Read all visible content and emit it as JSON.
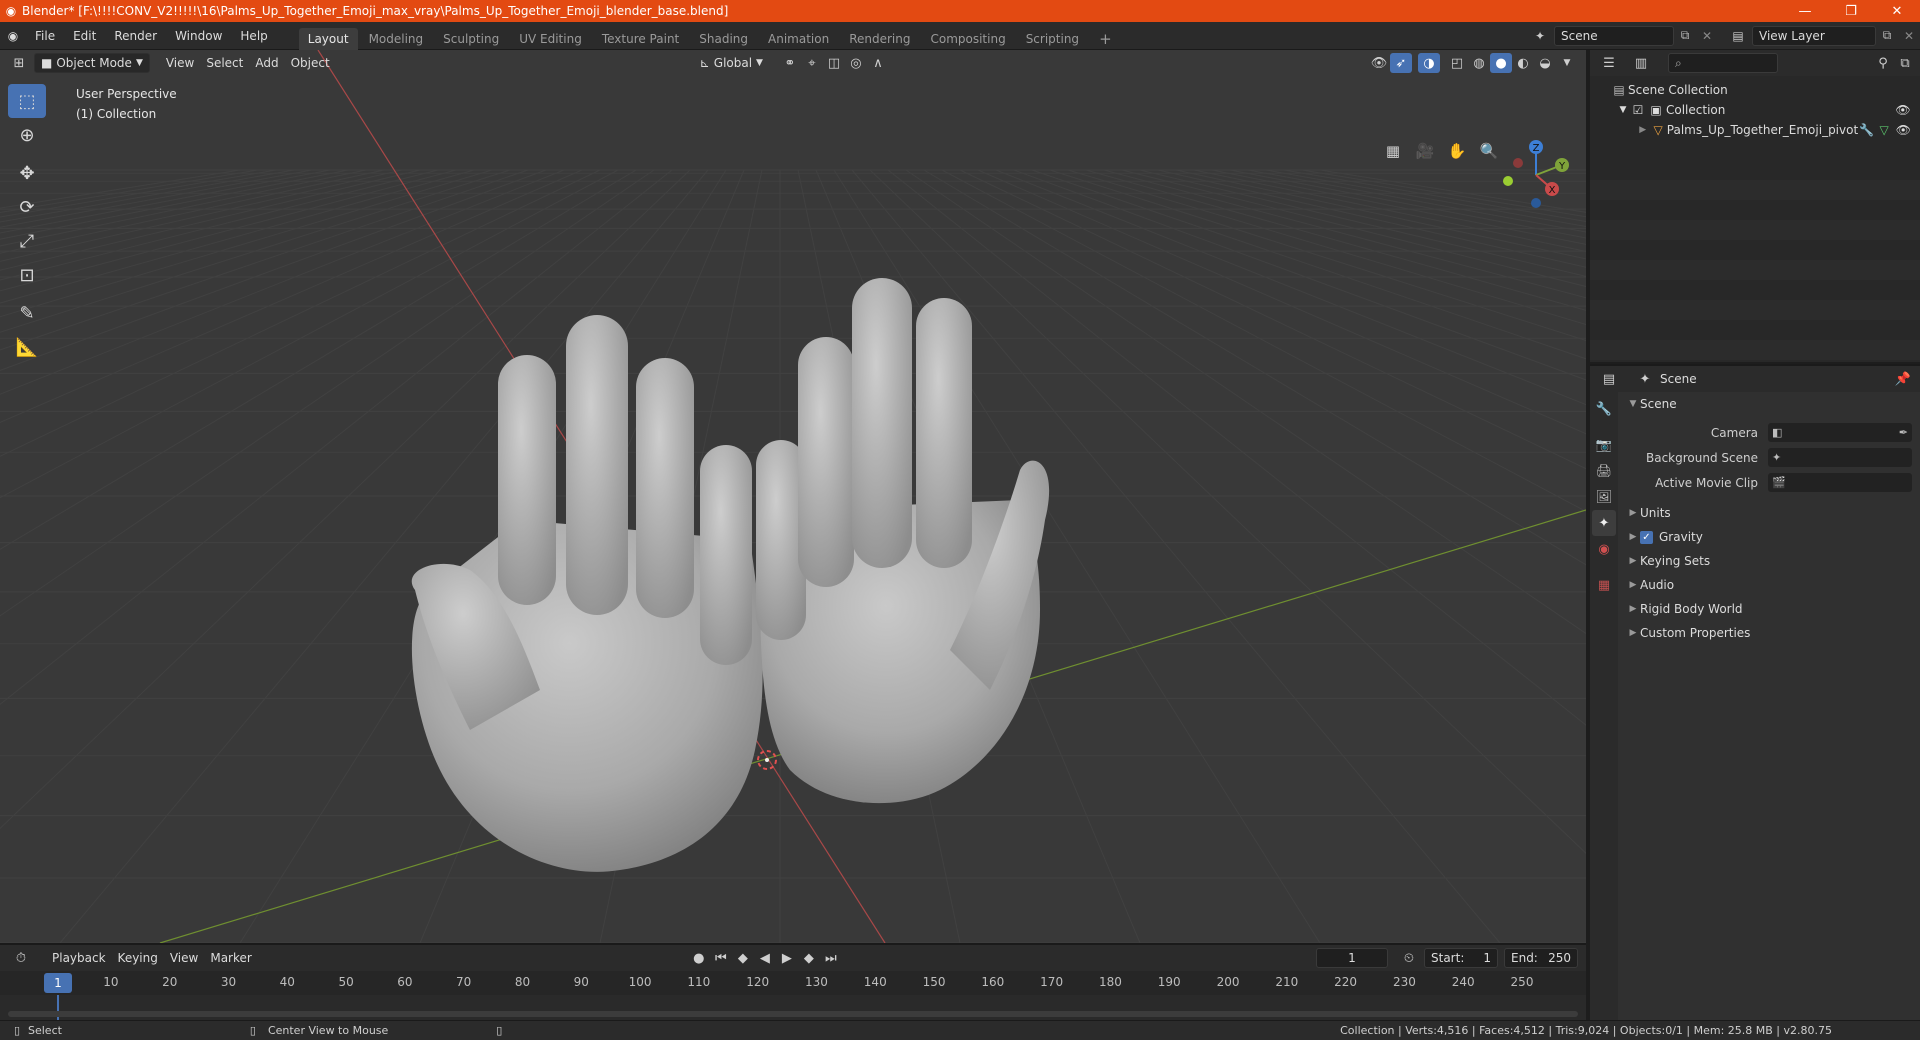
{
  "window": {
    "title": "Blender* [F:\\!!!!CONV_V2!!!!!\\16\\Palms_Up_Together_Emoji_max_vray\\Palms_Up_Together_Emoji_blender_base.blend]",
    "minimize": "—",
    "maximize": "❐",
    "close": "✕"
  },
  "menu": [
    "File",
    "Edit",
    "Render",
    "Window",
    "Help"
  ],
  "workspaces": {
    "tabs": [
      "Layout",
      "Modeling",
      "Sculpting",
      "UV Editing",
      "Texture Paint",
      "Shading",
      "Animation",
      "Rendering",
      "Compositing",
      "Scripting"
    ],
    "active": "Layout",
    "add": "+"
  },
  "scene_selector": {
    "value": "Scene"
  },
  "view_layer_selector": {
    "value": "View Layer"
  },
  "viewport": {
    "mode": "Object Mode",
    "menus": [
      "View",
      "Select",
      "Add",
      "Object"
    ],
    "orientation": "Global",
    "info_line1": "User Perspective",
    "info_line2": "(1) Collection",
    "gizmo": {
      "x": "X",
      "y": "Y",
      "z": "Z"
    }
  },
  "timeline": {
    "menus": [
      "Playback",
      "Keying",
      "View",
      "Marker"
    ],
    "current_frame": "1",
    "start_label": "Start:",
    "start": "1",
    "end_label": "End:",
    "end": "250",
    "ruler": [
      "10",
      "20",
      "30",
      "40",
      "50",
      "60",
      "70",
      "80",
      "90",
      "100",
      "110",
      "120",
      "130",
      "140",
      "150",
      "160",
      "170",
      "180",
      "190",
      "200",
      "210",
      "220",
      "230",
      "240",
      "250"
    ],
    "ruler_current": "1"
  },
  "status": {
    "select": "Select",
    "center_view": "Center View to Mouse",
    "stats": "Collection | Verts:4,516 | Faces:4,512 | Tris:9,024 | Objects:0/1 | Mem: 25.8 MB | v2.80.75"
  },
  "outliner": {
    "root": "Scene Collection",
    "collection": "Collection",
    "object": "Palms_Up_Together_Emoji_pivot"
  },
  "properties": {
    "context": "Scene",
    "panel": "Scene",
    "camera_label": "Camera",
    "background_scene_label": "Background Scene",
    "active_movie_clip_label": "Active Movie Clip",
    "subpanels": {
      "units": "Units",
      "gravity": "Gravity",
      "keying_sets": "Keying Sets",
      "audio": "Audio",
      "rigid_body_world": "Rigid Body World",
      "custom_properties": "Custom Properties"
    },
    "gravity_checked": true
  },
  "colors": {
    "titlebar": "#e34a12",
    "accent": "#4772b3",
    "viewport_bg": "#393939",
    "x_axis": "#c94a4a",
    "y_axis": "#7fa33a",
    "z_axis": "#3d7fd6"
  }
}
